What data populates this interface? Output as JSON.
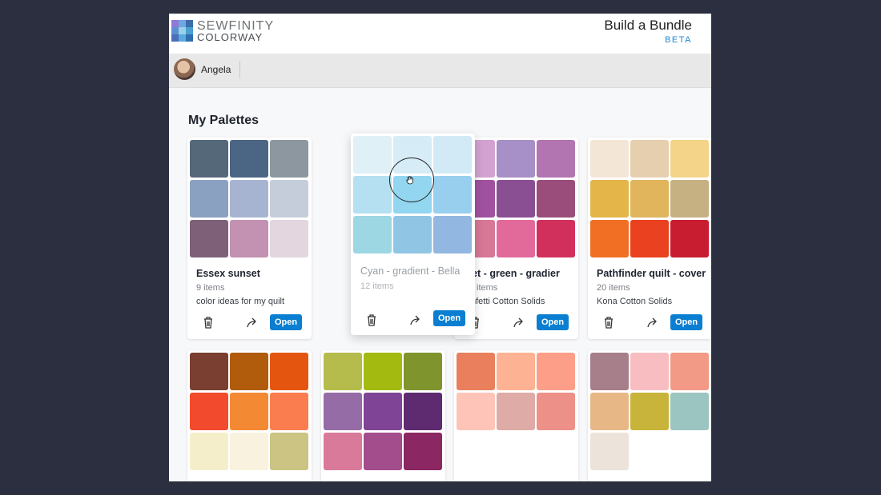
{
  "app": {
    "brand_line1": "SEWFINITY",
    "brand_line2": "COLORWAY",
    "title": "Build a Bundle",
    "badge": "BETA",
    "logo_colors": [
      "#8f7bd6",
      "#6fa7e0",
      "#3a6ea8",
      "#5b8fd0",
      "#9ad0e8",
      "#4aa0d0",
      "#4a6fb8",
      "#5aa8e0",
      "#2f6fb0"
    ]
  },
  "user": {
    "name": "Angela"
  },
  "section": {
    "title": "My Palettes"
  },
  "actions": {
    "open_label": "Open",
    "delete_icon": "trash-icon",
    "share_icon": "share-arrow-icon"
  },
  "palettes": [
    {
      "name": "Essex sunset",
      "count": "9 items",
      "desc": "color ideas for my quilt",
      "colors": [
        "#55687a",
        "#4b6584",
        "#8c979f",
        "#8aa1c2",
        "#a7b4d1",
        "#c4cdd9",
        "#7e6178",
        "#c391b2",
        "#e3d6df"
      ]
    },
    {
      "name": "Cyan - gradient - Bella",
      "count": "12 items",
      "desc": "",
      "colors": [
        "#dff0f7",
        "#d6ecf6",
        "#d1eaf6",
        "#b4e0f2",
        "#93d6f0",
        "#98cfee",
        "#9ed7e4",
        "#91c5e4",
        "#92b7e0"
      ]
    },
    {
      "name": "olet - green - gradier",
      "count": "items",
      "desc": "nfetti Cotton Solids",
      "colors": [
        "#d4a2d1",
        "#a78fc7",
        "#b374b2",
        "#a052a0",
        "#8a4e93",
        "#9a4d7b",
        "#d77896",
        "#e26a9b",
        "#d1305d"
      ]
    },
    {
      "name": "Pathfinder quilt - cover",
      "count": "20 items",
      "desc": "Kona Cotton Solids",
      "colors": [
        "#f4e6d6",
        "#e6cfaf",
        "#f4d488",
        "#e4b649",
        "#e0b55c",
        "#c6b183",
        "#f06f25",
        "#ea4120",
        "#c81d30"
      ]
    },
    {
      "name": "",
      "count": "",
      "desc": "",
      "colors": [
        "#7a3f30",
        "#b05c0c",
        "#e45610",
        "#f24a2c",
        "#f48933",
        "#fa7d4f",
        "#f5eecb",
        "#f8f2de",
        "#cbc483"
      ]
    },
    {
      "name": "",
      "count": "",
      "desc": "",
      "colors": [
        "#b5bc4b",
        "#a3bb10",
        "#80942d",
        "#956ca6",
        "#7f4495",
        "#5f2b70",
        "#d97a9a",
        "#a34d8c",
        "#8b2863"
      ]
    },
    {
      "name": "",
      "count": "",
      "desc": "",
      "colors": [
        "#e97f5c",
        "#fdb293",
        "#fd9e88",
        "#fec4b7",
        "#deaba6",
        "#ec9088"
      ]
    },
    {
      "name": "",
      "count": "",
      "desc": "",
      "colors": [
        "#a77f8a",
        "#f8bdc0",
        "#f29a86",
        "#e8b786",
        "#c8b43a",
        "#9bc5c0",
        "#ece3db"
      ]
    }
  ]
}
